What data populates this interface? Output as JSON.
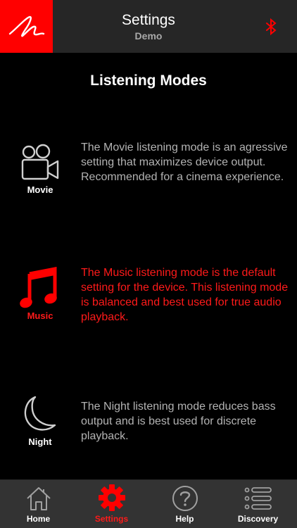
{
  "header": {
    "title": "Settings",
    "subtitle": "Demo"
  },
  "section": {
    "title": "Listening Modes"
  },
  "modes": [
    {
      "name": "Movie",
      "description": "The Movie listening mode is an agressive setting that maximizes device output. Recommended for a cinema experience.",
      "selected": false
    },
    {
      "name": "Music",
      "description": "The Music listening mode is the default setting for the device. This listening mode is balanced and best used for true audio playback.",
      "selected": true
    },
    {
      "name": "Night",
      "description": "The Night listening mode reduces bass output and is best used for discrete playback.",
      "selected": false
    }
  ],
  "tabs": [
    {
      "label": "Home",
      "icon": "home-icon",
      "active": false
    },
    {
      "label": "Settings",
      "icon": "gear-icon",
      "active": true
    },
    {
      "label": "Help",
      "icon": "help-icon",
      "active": false
    },
    {
      "label": "Discovery",
      "icon": "list-icon",
      "active": false
    }
  ],
  "colors": {
    "accent": "#ff0000",
    "header_bg": "#262626",
    "tabbar_bg": "#333333",
    "inactive_text": "#b3b3b3"
  }
}
